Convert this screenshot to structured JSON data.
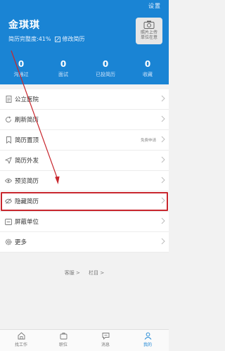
{
  "header": {
    "settings_label": "设置",
    "user_name": "金琪琪",
    "completeness": "简历完整度:41%",
    "edit_label": "修改简历",
    "photo_text_1": "照片上传",
    "photo_text_2": "单位在意",
    "stats": [
      {
        "value": "0",
        "label": "沟通过"
      },
      {
        "value": "0",
        "label": "面试"
      },
      {
        "value": "0",
        "label": "已投简历"
      },
      {
        "value": "0",
        "label": "收藏"
      }
    ]
  },
  "menu": {
    "items": [
      {
        "label": "公立医院",
        "icon": "document-icon"
      },
      {
        "label": "刷新简历",
        "icon": "refresh-icon"
      },
      {
        "label": "简历置顶",
        "icon": "bookmark-icon",
        "tag": "免费申请"
      },
      {
        "label": "简历外发",
        "icon": "send-icon"
      },
      {
        "label": "预览简历",
        "icon": "eye-icon"
      },
      {
        "label": "隐藏简历",
        "icon": "eye-off-icon"
      },
      {
        "label": "屏蔽单位",
        "icon": "block-icon"
      },
      {
        "label": "更多",
        "icon": "gear-icon"
      }
    ]
  },
  "links": {
    "service": "客服 >",
    "column": "栏目 >"
  },
  "tabbar": {
    "tabs": [
      {
        "label": "找工作",
        "icon": "home-icon"
      },
      {
        "label": "职位",
        "icon": "briefcase-icon"
      },
      {
        "label": "消息",
        "icon": "message-icon"
      },
      {
        "label": "我的",
        "icon": "user-icon"
      }
    ]
  },
  "colors": {
    "brand": "#1a84d4",
    "highlight": "#c8262d",
    "arrow": "#c8262d"
  }
}
